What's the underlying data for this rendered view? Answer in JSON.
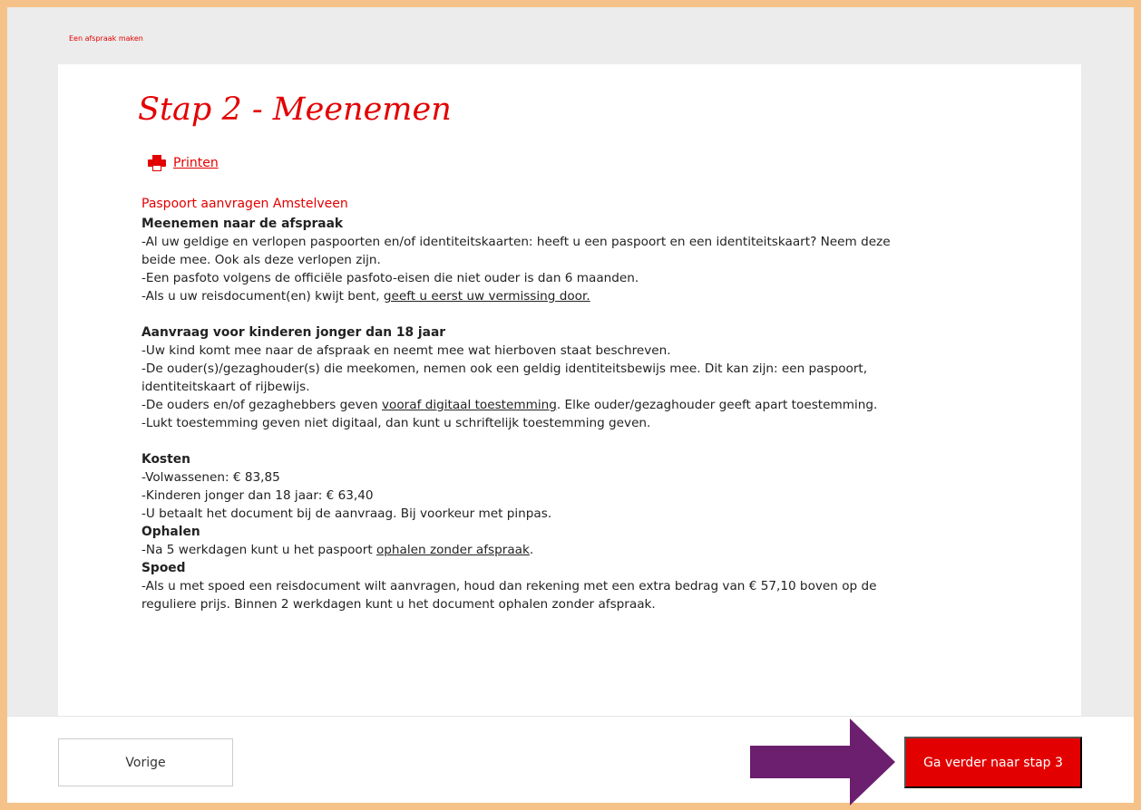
{
  "breadcrumb": "Een afspraak maken",
  "title": "Stap 2 - Meenemen",
  "print_label": "Printen",
  "subtitle": "Paspoort aanvragen Amstelveen",
  "section1": {
    "heading": "Meenemen naar de afspraak",
    "l1": "-Al uw geldige en verlopen paspoorten en/of identiteitskaarten: heeft u een paspoort en een identiteitskaart? Neem deze",
    "l2": "beide mee. Ook als deze verlopen zijn.",
    "l3": "-Een pasfoto volgens de officiële pasfoto-eisen die niet ouder is dan 6 maanden.",
    "l4_pre": "-Als u uw reisdocument(en) kwijt bent, ",
    "l4_link": "geeft u eerst uw vermissing door."
  },
  "section2": {
    "heading": "Aanvraag voor kinderen jonger dan 18 jaar",
    "l1": "-Uw kind komt mee naar de afspraak en neemt mee wat hierboven staat beschreven.",
    "l2": "-De ouder(s)/gezaghouder(s) die meekomen, nemen ook een geldig identiteitsbewijs mee. Dit kan zijn: een paspoort,",
    "l3": "identiteitskaart of rijbewijs.",
    "l4_pre": "-De ouders en/of gezaghebbers geven ",
    "l4_link": "vooraf digitaal toestemming",
    "l4_post": ". Elke ouder/gezaghouder geeft apart toestemming.",
    "l5": "-Lukt toestemming geven niet digitaal, dan kunt u schriftelijk toestemming geven."
  },
  "costs": {
    "heading": "Kosten",
    "l1": "-Volwassenen: € 83,85",
    "l2": "-Kinderen jonger dan 18 jaar: € 63,40",
    "l3": "-U betaalt het document bij de aanvraag. Bij voorkeur met pinpas."
  },
  "pickup": {
    "heading": "Ophalen",
    "l1_pre": "-Na 5 werkdagen kunt u het paspoort ",
    "l1_link": "ophalen zonder afspraak",
    "l1_post": "."
  },
  "urgent": {
    "heading": "Spoed",
    "l1": "-Als u met spoed een reisdocument wilt aanvragen, houd dan rekening met een extra bedrag van € 57,10 boven op de",
    "l2": "reguliere prijs. Binnen 2 werkdagen kunt u het document ophalen zonder afspraak."
  },
  "buttons": {
    "prev": "Vorige",
    "next": "Ga verder naar stap 3"
  },
  "colors": {
    "accent": "#e30000",
    "frame": "#f5c38a",
    "arrow": "#6b1f6e"
  },
  "icons": {
    "print": "printer-icon",
    "arrow": "arrow-right-icon"
  }
}
